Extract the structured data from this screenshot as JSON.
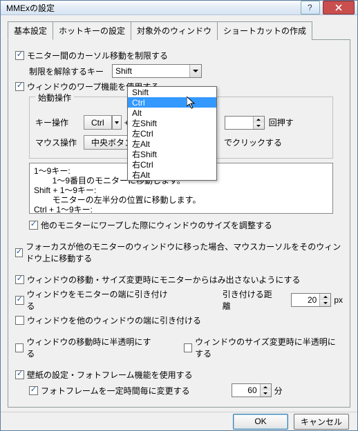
{
  "window": {
    "title": "MMExの設定"
  },
  "tabs": [
    "基本設定",
    "ホットキーの設定",
    "対象外のウィンドウ",
    "ショートカットの作成"
  ],
  "active_tab": 0,
  "chk_monitor_move": {
    "checked": true,
    "label": "モニター間のカーソル移動を制限する"
  },
  "release_key": {
    "label": "制限を解除するキー",
    "value": "Shift",
    "options": [
      "Shift",
      "Ctrl",
      "Alt",
      "左Shift",
      "左Ctrl",
      "左Alt",
      "右Shift",
      "右Ctrl",
      "右Alt"
    ],
    "highlighted_index": 1
  },
  "chk_warp": {
    "checked": true,
    "label": "ウィンドウのワープ機能を使用する"
  },
  "group_start": {
    "legend": "始動操作",
    "key_label": "キー操作",
    "key1": "Ctrl",
    "key2": "",
    "key_hint": "回押す",
    "mouse_label": "マウス操作",
    "mouse_btn": "中央ボタン",
    "mouse_hint": "でクリックする"
  },
  "info_text": "1～9キー:\n        1～9番目のモニターに移動します。\nShift + 1～9キー:\n        モニターの左半分の位置に移動します。\nCtrl + 1～9キー:",
  "chk_resize_on_warp": {
    "checked": true,
    "label": "他のモニターにワープした際にウィンドウのサイズを調整する"
  },
  "chk_focus_move": {
    "checked": true,
    "label": "フォーカスが他のモニターのウィンドウに移った場合、マウスカーソルをそのウィンドウ上に移動する"
  },
  "chk_no_protrude": {
    "checked": true,
    "label": "ウィンドウの移動・サイズ変更時にモニターからはみ出さないようにする"
  },
  "chk_snap_monitor": {
    "checked": true,
    "label": "ウィンドウをモニターの端に引き付ける"
  },
  "snap_distance": {
    "label": "引き付ける距離",
    "value": "20",
    "unit": "px"
  },
  "chk_snap_window": {
    "checked": false,
    "label": "ウィンドウを他のウィンドウの端に引き付ける"
  },
  "chk_trans_move": {
    "checked": false,
    "label": "ウィンドウの移動時に半透明にする"
  },
  "chk_trans_size": {
    "checked": false,
    "label": "ウィンドウのサイズ変更時に半透明にする"
  },
  "chk_wallpaper": {
    "checked": true,
    "label": "壁紙の設定・フォトフレーム機能を使用する"
  },
  "chk_photoframe": {
    "checked": true,
    "label": "フォトフレームを一定時間毎に変更する"
  },
  "photoframe_interval": {
    "value": "60",
    "unit": "分"
  },
  "footer": {
    "ok": "OK",
    "cancel": "キャンセル"
  }
}
